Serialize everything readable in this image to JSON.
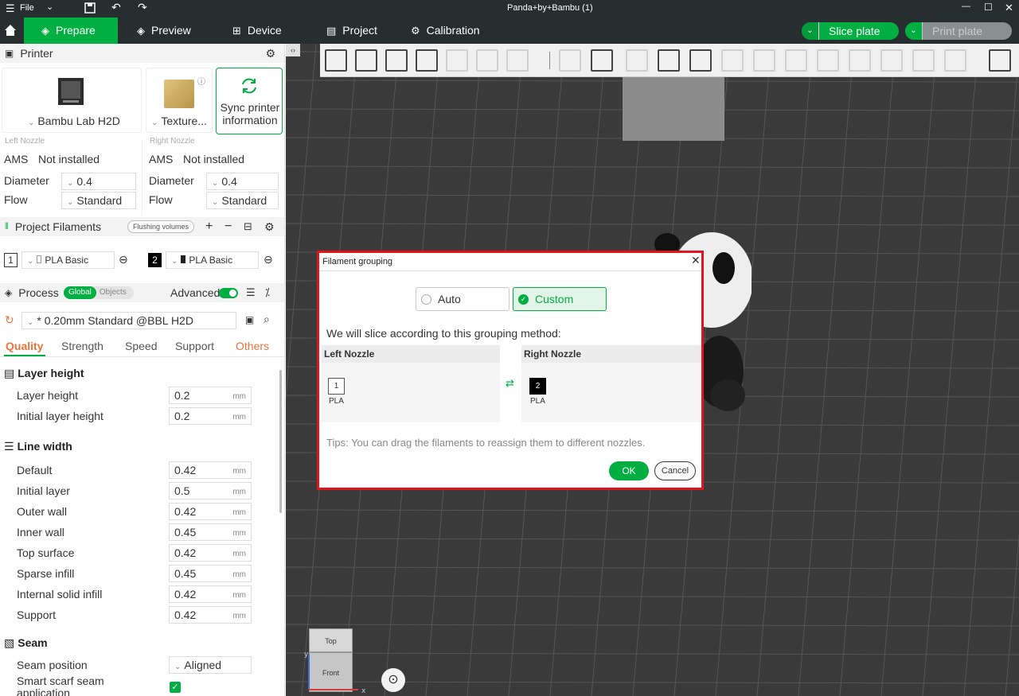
{
  "titlebar": {
    "file_label": "File",
    "title": "Panda+by+Bambu (1)"
  },
  "tabs": [
    {
      "label": "Prepare"
    },
    {
      "label": "Preview"
    },
    {
      "label": "Device"
    },
    {
      "label": "Project"
    },
    {
      "label": "Calibration"
    }
  ],
  "actions": {
    "slice": "Slice plate",
    "print": "Print plate"
  },
  "printer": {
    "header": "Printer",
    "name": "Bambu Lab H2D",
    "plate": "Texture...",
    "sync": "Sync printer information",
    "left_nozzle": {
      "title": "Left Nozzle",
      "ams_label": "AMS",
      "ams_value": "Not installed",
      "diameter_label": "Diameter",
      "diameter": "0.4",
      "flow_label": "Flow",
      "flow": "Standard"
    },
    "right_nozzle": {
      "title": "Right Nozzle",
      "ams_label": "AMS",
      "ams_value": "Not installed",
      "diameter_label": "Diameter",
      "diameter": "0.4",
      "flow_label": "Flow",
      "flow": "Standard"
    }
  },
  "filaments": {
    "header": "Project Filaments",
    "flushing": "Flushing volumes",
    "items": [
      {
        "index": "1",
        "name": "PLA Basic",
        "color": "#ffffff"
      },
      {
        "index": "2",
        "name": "PLA Basic",
        "color": "#000000"
      }
    ]
  },
  "process": {
    "header": "Process",
    "global": "Global",
    "objects": "Objects",
    "advanced": "Advanced",
    "preset": "* 0.20mm Standard @BBL H2D",
    "tabs": [
      "Quality",
      "Strength",
      "Speed",
      "Support",
      "Others"
    ],
    "groups": {
      "layer_height": {
        "title": "Layer height",
        "rows": [
          {
            "label": "Layer height",
            "value": "0.2",
            "unit": "mm"
          },
          {
            "label": "Initial layer height",
            "value": "0.2",
            "unit": "mm"
          }
        ]
      },
      "line_width": {
        "title": "Line width",
        "rows": [
          {
            "label": "Default",
            "value": "0.42",
            "unit": "mm"
          },
          {
            "label": "Initial layer",
            "value": "0.5",
            "unit": "mm"
          },
          {
            "label": "Outer wall",
            "value": "0.42",
            "unit": "mm"
          },
          {
            "label": "Inner wall",
            "value": "0.45",
            "unit": "mm"
          },
          {
            "label": "Top surface",
            "value": "0.42",
            "unit": "mm"
          },
          {
            "label": "Sparse infill",
            "value": "0.45",
            "unit": "mm"
          },
          {
            "label": "Internal solid infill",
            "value": "0.42",
            "unit": "mm"
          },
          {
            "label": "Support",
            "value": "0.42",
            "unit": "mm"
          }
        ]
      },
      "seam": {
        "title": "Seam",
        "position_label": "Seam position",
        "position_value": "Aligned",
        "scarf_label": "Smart scarf seam application"
      }
    }
  },
  "viewcube": {
    "top": "Top",
    "front": "Front"
  },
  "dialog": {
    "title": "Filament grouping",
    "auto": "Auto",
    "custom": "Custom",
    "message": "We will slice according to this grouping method:",
    "left_nozzle": "Left Nozzle",
    "right_nozzle": "Right Nozzle",
    "left_filament": {
      "index": "1",
      "type": "PLA"
    },
    "right_filament": {
      "index": "2",
      "type": "PLA"
    },
    "tips": "Tips: You can drag the filaments to reassign them to different nozzles.",
    "ok": "OK",
    "cancel": "Cancel"
  },
  "colors": {
    "accent": "#00ae42",
    "dark": "#262e30",
    "dialog_border": "#e0141c",
    "others_tab": "#e8743b"
  }
}
